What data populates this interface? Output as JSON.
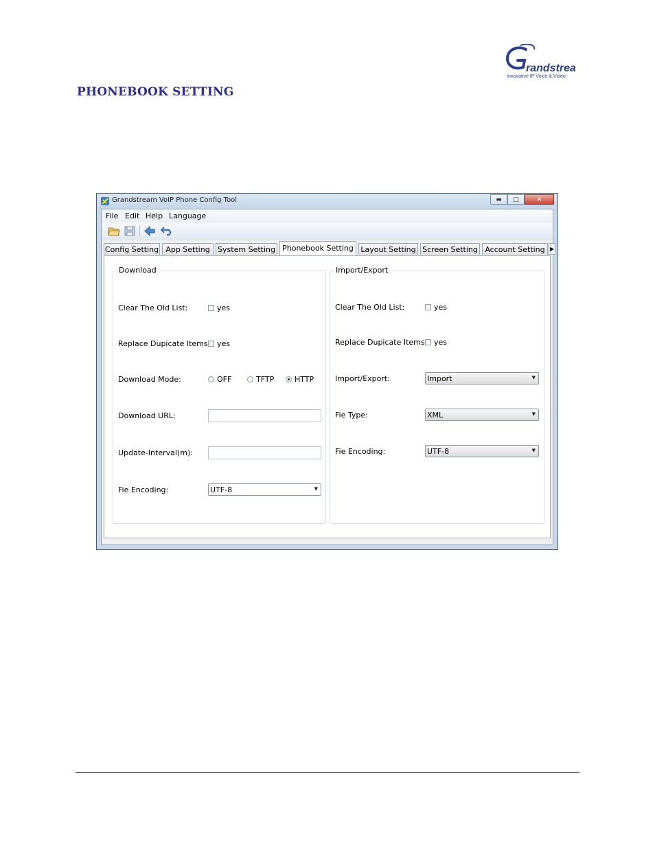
{
  "logo": {
    "brand": "Grandstream",
    "tagline": "Innovative IP Voice & Video"
  },
  "page": {
    "heading": "PHONEBOOK SETTING"
  },
  "window": {
    "title": "Grandstream VoIP Phone Config Tool",
    "menu": [
      "File",
      "Edit",
      "Help",
      "Language"
    ],
    "tabs": [
      "Config Setting",
      "App Setting",
      "System Setting",
      "Phonebook Setting",
      "Layout Setting",
      "Screen Setting",
      "Account Setting"
    ],
    "active_tab": "Phonebook Setting"
  },
  "download": {
    "title": "Download",
    "clear_label": "Clear The Old List:",
    "clear_yes": "yes",
    "replace_label": "Replace Dupicate Items:",
    "replace_yes": "yes",
    "mode_label": "Download Mode:",
    "mode_off": "OFF",
    "mode_tftp": "TFTP",
    "mode_http": "HTTP",
    "mode_selected": "HTTP",
    "url_label": "Download URL:",
    "url_value": "",
    "interval_label": "Update-Interval(m):",
    "interval_value": "",
    "encoding_label": "Fie Encoding:",
    "encoding_value": "UTF-8"
  },
  "importexport": {
    "title": "Import/Export",
    "clear_label": "Clear The Old List:",
    "clear_yes": "yes",
    "replace_label": "Replace Dupicate Items:",
    "replace_yes": "yes",
    "mode_label": "Import/Export:",
    "mode_value": "Import",
    "filetype_label": "Fie Type:",
    "filetype_value": "XML",
    "encoding_label": "Fie Encoding:",
    "encoding_value": "UTF-8"
  },
  "colors": {
    "heading": "#2e2e8f",
    "brand": "#2b3f8c",
    "titlebar": "#c9d9ea"
  },
  "icons": [
    "open-folder-icon",
    "save-icon",
    "back-arrow-icon",
    "undo-icon",
    "app-icon",
    "minimize-icon",
    "maximize-icon",
    "close-icon",
    "chevron-right-icon",
    "chevron-down-icon"
  ]
}
